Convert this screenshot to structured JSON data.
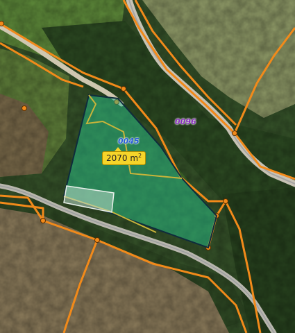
{
  "map": {
    "parcels": [
      {
        "id": "0045",
        "text_color": "#2a5fd8"
      },
      {
        "id": "0096",
        "text_color": "#8a2fc0"
      }
    ],
    "selected_area": {
      "value": "2070 m",
      "unit_superscript": "2"
    },
    "colors": {
      "parcel_boundary": "#f28a1a",
      "selection_fill": "#1fb896",
      "selection_outline": "#0f2c3c",
      "road": "#9aa0a6",
      "area_badge": "#f6d52a"
    }
  }
}
